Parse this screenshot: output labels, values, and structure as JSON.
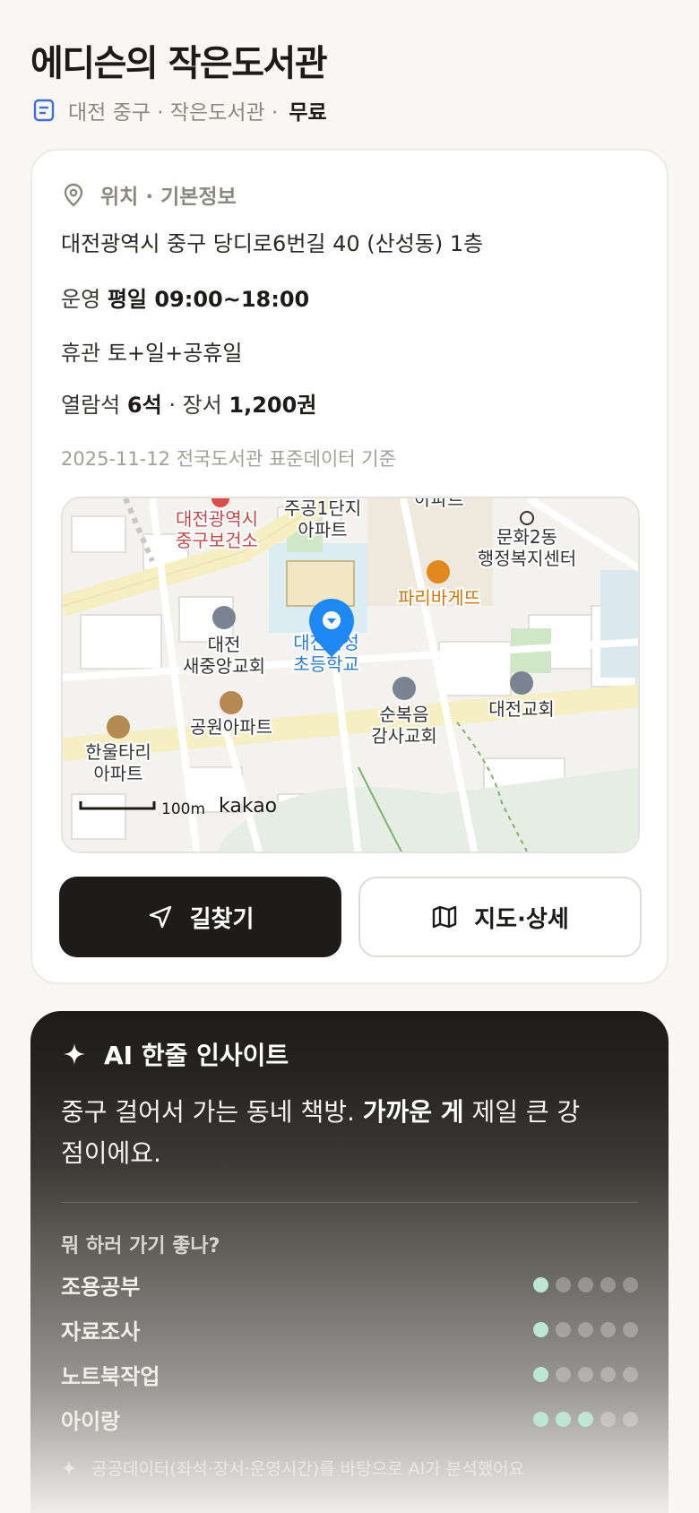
{
  "header": {
    "title": "에디슨의 작은도서관",
    "meta": "대전 중구 · 작은도서관 ·",
    "free_label": "무료"
  },
  "info": {
    "section_title": "위치 · 기본정보",
    "address": "대전광역시 중구 당디로6번길 40 (산성동) 1층",
    "hours_label": "운영",
    "hours_value": "평일 09:00~18:00",
    "closed_label": "휴관",
    "closed_value": "토+일+공휴일",
    "seats_label": "열람석",
    "seats_value": "6석",
    "books_label": "· 장서",
    "books_value": "1,200권",
    "source_note": "2025-11-12 전국도서관 표준데이터 기준"
  },
  "map": {
    "labels": {
      "health_center": "대전광역시 중구보건소",
      "health_line1": "대전광역시",
      "health_line2": "중구보건소",
      "apt1_line1": "주공1단지",
      "apt1_line2": "아파트",
      "apt_top": "아파트",
      "office_line1": "문화2동",
      "office_line2": "행정복지센터",
      "bakery": "파리바게뜨",
      "church1_line1": "대전",
      "church1_line2": "새중앙교회",
      "school_line1": "대전산성",
      "school_line2": "초등학교",
      "church2_line1": "순복음",
      "church2_line2": "감사교회",
      "church3": "대전교회",
      "apt2": "공원아파트",
      "apt3_line1": "한울타리",
      "apt3_line2": "아파트",
      "scale": "100m",
      "brand": "kakao"
    }
  },
  "buttons": {
    "directions": "길찾기",
    "map_detail": "지도·상세"
  },
  "ai": {
    "title": "AI 한줄 인사이트",
    "text_a": "중구 걸어서 가는 동네 책방. ",
    "text_bold": "가까운 게",
    "text_b": " 제일 큰 강점이에요.",
    "question": "뭐 하러 가기 좋나?",
    "ratings": [
      {
        "label": "조용공부",
        "score": 1,
        "max": 5
      },
      {
        "label": "자료조사",
        "score": 1,
        "max": 5
      },
      {
        "label": "노트북작업",
        "score": 1,
        "max": 5
      },
      {
        "label": "아이랑",
        "score": 3,
        "max": 5
      }
    ],
    "footnote": "공공데이터(좌석·장서·운영시간)를 바탕으로 AI가 분석했어요"
  },
  "colors": {
    "accent_dark": "#1d1c1a",
    "dot_on": "#bfe6d5",
    "map_pin": "#1e88f5"
  }
}
